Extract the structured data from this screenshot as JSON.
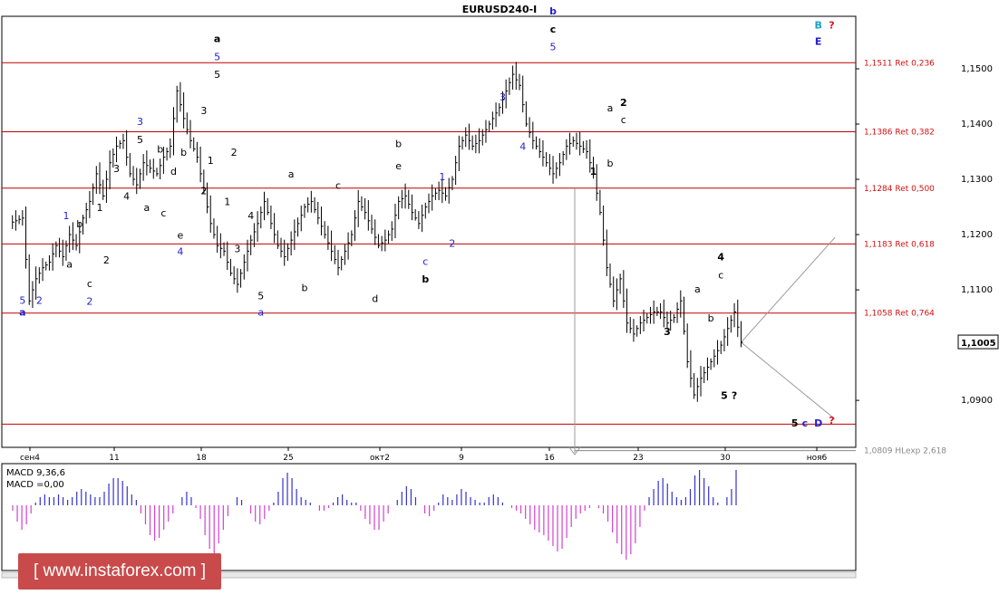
{
  "title": "EURUSD240-I",
  "chart_data": [
    {
      "type": "ohlc",
      "title": "EURUSD240-I",
      "ylim": [
        1.0815,
        1.1595
      ],
      "price_ticks": [
        "1,1500",
        "1,1400",
        "1,1300",
        "1,1200",
        "1,1100",
        "1,0900"
      ],
      "price_tick_values": [
        1.15,
        1.14,
        1.13,
        1.12,
        1.11,
        1.09
      ],
      "x_ticks": [
        "сен4",
        "11",
        "18",
        "25",
        "окт2",
        "9",
        "16",
        "23",
        "30",
        "ноя6"
      ],
      "current_price": "1,1005",
      "current_price_value": 1.1005,
      "fib_levels": [
        {
          "label": "1,1511 Ret 0,236",
          "value": 1.1511
        },
        {
          "label": "1,1386 Ret 0,382",
          "value": 1.1386
        },
        {
          "label": "1,1284 Ret 0,500",
          "value": 1.1284
        },
        {
          "label": "1,1183 Ret 0,618",
          "value": 1.1183
        },
        {
          "label": "1,1058 Ret 0,764",
          "value": 1.1058
        }
      ],
      "extra_level": {
        "value": 1.0857
      },
      "extension_level": {
        "label": "1,0809 HLexp 2,618",
        "value": 1.0809
      },
      "price_path": [
        [
          0,
          1.122
        ],
        [
          4,
          1.123
        ],
        [
          6,
          1.108
        ],
        [
          8,
          1.112
        ],
        [
          10,
          1.114
        ],
        [
          12,
          1.115
        ],
        [
          14,
          1.118
        ],
        [
          16,
          1.116
        ],
        [
          18,
          1.12
        ],
        [
          20,
          1.118
        ],
        [
          22,
          1.123
        ],
        [
          24,
          1.126
        ],
        [
          26,
          1.131
        ],
        [
          28,
          1.127
        ],
        [
          30,
          1.133
        ],
        [
          32,
          1.136
        ],
        [
          34,
          1.137
        ],
        [
          36,
          1.131
        ],
        [
          38,
          1.129
        ],
        [
          40,
          1.133
        ],
        [
          42,
          1.132
        ],
        [
          44,
          1.131
        ],
        [
          46,
          1.134
        ],
        [
          48,
          1.136
        ],
        [
          50,
          1.146
        ],
        [
          52,
          1.141
        ],
        [
          54,
          1.137
        ],
        [
          56,
          1.134
        ],
        [
          58,
          1.128
        ],
        [
          60,
          1.122
        ],
        [
          62,
          1.118
        ],
        [
          64,
          1.117
        ],
        [
          66,
          1.113
        ],
        [
          68,
          1.111
        ],
        [
          70,
          1.115
        ],
        [
          72,
          1.119
        ],
        [
          74,
          1.122
        ],
        [
          76,
          1.126
        ],
        [
          78,
          1.122
        ],
        [
          80,
          1.118
        ],
        [
          82,
          1.116
        ],
        [
          84,
          1.119
        ],
        [
          86,
          1.122
        ],
        [
          88,
          1.125
        ],
        [
          90,
          1.126
        ],
        [
          92,
          1.123
        ],
        [
          94,
          1.12
        ],
        [
          96,
          1.117
        ],
        [
          98,
          1.114
        ],
        [
          100,
          1.117
        ],
        [
          102,
          1.12
        ],
        [
          104,
          1.126
        ],
        [
          106,
          1.124
        ],
        [
          108,
          1.121
        ],
        [
          110,
          1.118
        ],
        [
          112,
          1.119
        ],
        [
          114,
          1.121
        ],
        [
          116,
          1.126
        ],
        [
          118,
          1.127
        ],
        [
          120,
          1.124
        ],
        [
          122,
          1.122
        ],
        [
          124,
          1.125
        ],
        [
          126,
          1.127
        ],
        [
          128,
          1.128
        ],
        [
          130,
          1.127
        ],
        [
          132,
          1.13
        ],
        [
          134,
          1.136
        ],
        [
          136,
          1.138
        ],
        [
          138,
          1.136
        ],
        [
          140,
          1.137
        ],
        [
          142,
          1.139
        ],
        [
          144,
          1.141
        ],
        [
          146,
          1.143
        ],
        [
          148,
          1.146
        ],
        [
          150,
          1.149
        ],
        [
          152,
          1.147
        ],
        [
          154,
          1.14
        ],
        [
          156,
          1.137
        ],
        [
          158,
          1.135
        ],
        [
          160,
          1.133
        ],
        [
          162,
          1.131
        ],
        [
          164,
          1.133
        ],
        [
          166,
          1.136
        ],
        [
          168,
          1.137
        ],
        [
          170,
          1.136
        ],
        [
          172,
          1.135
        ],
        [
          174,
          1.131
        ],
        [
          176,
          1.124
        ],
        [
          178,
          1.114
        ],
        [
          180,
          1.108
        ],
        [
          182,
          1.112
        ],
        [
          184,
          1.104
        ],
        [
          186,
          1.102
        ],
        [
          188,
          1.104
        ],
        [
          190,
          1.105
        ],
        [
          192,
          1.106
        ],
        [
          194,
          1.106
        ],
        [
          196,
          1.104
        ],
        [
          198,
          1.105
        ],
        [
          200,
          1.108
        ],
        [
          202,
          1.097
        ],
        [
          204,
          1.091
        ],
        [
          206,
          1.094
        ],
        [
          208,
          1.096
        ],
        [
          210,
          1.098
        ],
        [
          212,
          1.1
        ],
        [
          214,
          1.103
        ],
        [
          216,
          1.106
        ],
        [
          218,
          1.1005
        ]
      ],
      "indicator": {
        "name": "MACD",
        "label_line1": "MACD 9,36,6",
        "label_line2": "MACD =0,00",
        "histogram": [
          -0.2,
          -0.6,
          -0.9,
          -0.7,
          -0.3,
          0.1,
          0.3,
          0.4,
          0.3,
          0.3,
          0.4,
          0.3,
          0.2,
          0.3,
          0.5,
          0.6,
          0.5,
          0.4,
          0.3,
          0.3,
          0.5,
          0.8,
          1.0,
          1.0,
          0.9,
          0.7,
          0.4,
          0.2,
          -0.3,
          -0.7,
          -1.1,
          -1.3,
          -1.2,
          -0.9,
          -0.6,
          -0.3,
          0.0,
          0.3,
          0.5,
          0.3,
          -0.1,
          -0.5,
          -1.1,
          -1.6,
          -1.8,
          -1.4,
          -0.9,
          -0.4,
          0.0,
          0.3,
          0.2,
          0.0,
          -0.3,
          -0.6,
          -0.7,
          -0.5,
          -0.2,
          0.1,
          0.5,
          1.0,
          1.2,
          1.0,
          0.6,
          0.3,
          0.2,
          0.1,
          0.0,
          -0.2,
          -0.2,
          -0.1,
          0.1,
          0.3,
          0.4,
          0.2,
          0.1,
          0.1,
          -0.2,
          -0.5,
          -0.7,
          -0.9,
          -0.9,
          -0.6,
          -0.3,
          0.0,
          0.2,
          0.5,
          0.7,
          0.6,
          0.3,
          0.0,
          -0.3,
          -0.4,
          -0.2,
          0.1,
          0.4,
          0.3,
          0.2,
          0.4,
          0.6,
          0.5,
          0.3,
          0.2,
          0.1,
          0.1,
          0.3,
          0.4,
          0.3,
          0.1,
          0.0,
          -0.1,
          -0.2,
          -0.3,
          -0.5,
          -0.7,
          -0.9,
          -1.0,
          -1.1,
          -1.3,
          -1.5,
          -1.7,
          -1.6,
          -1.2,
          -0.8,
          -0.5,
          -0.3,
          -0.2,
          -0.1,
          0.0,
          -0.1,
          -0.3,
          -0.6,
          -1.0,
          -1.4,
          -1.8,
          -2.0,
          -1.8,
          -1.4,
          -0.8,
          -0.2,
          0.3,
          0.6,
          0.9,
          1.0,
          0.8,
          0.5,
          0.3,
          0.2,
          0.3,
          0.6,
          1.1,
          1.3,
          1.0,
          0.7,
          0.3,
          0.1,
          0.0,
          0.3,
          0.6,
          1.3
        ]
      }
    }
  ],
  "wave_labels": [
    {
      "text": "5",
      "x": 4,
      "y": 1.1075,
      "color": "#1f1fd1"
    },
    {
      "text": "a",
      "x": 4,
      "y": 1.1073,
      "color": "#1f1fd1",
      "bold": true,
      "dy": 12
    },
    {
      "text": "2",
      "x": 9,
      "y": 1.1075,
      "color": "#1f1fd1"
    },
    {
      "text": "1",
      "x": 17,
      "y": 1.1228,
      "color": "#1f1fd1"
    },
    {
      "text": "a",
      "x": 18,
      "y": 1.114,
      "color": "#000000"
    },
    {
      "text": "b",
      "x": 21,
      "y": 1.1213,
      "color": "#000000"
    },
    {
      "text": "c",
      "x": 24,
      "y": 1.1105,
      "color": "#000000"
    },
    {
      "text": "2",
      "x": 24,
      "y": 1.1093,
      "color": "#1f1fd1",
      "dy": 12
    },
    {
      "text": "1",
      "x": 27,
      "y": 1.1243,
      "color": "#000000"
    },
    {
      "text": "2",
      "x": 29,
      "y": 1.1148,
      "color": "#000000"
    },
    {
      "text": "3",
      "x": 32,
      "y": 1.1313,
      "color": "#000000"
    },
    {
      "text": "4",
      "x": 35,
      "y": 1.1263,
      "color": "#000000"
    },
    {
      "text": "3",
      "x": 39,
      "y": 1.1398,
      "color": "#1f1fd1"
    },
    {
      "text": "5",
      "x": 39,
      "y": 1.1385,
      "color": "#000000",
      "dy": 12
    },
    {
      "text": "a",
      "x": 41,
      "y": 1.1243,
      "color": "#000000"
    },
    {
      "text": "b",
      "x": 45,
      "y": 1.1348,
      "color": "#000000"
    },
    {
      "text": "c",
      "x": 46,
      "y": 1.1233,
      "color": "#000000"
    },
    {
      "text": "d",
      "x": 49,
      "y": 1.1308,
      "color": "#000000"
    },
    {
      "text": "b",
      "x": 52,
      "y": 1.1343,
      "color": "#000000"
    },
    {
      "text": "e",
      "x": 51,
      "y": 1.1193,
      "color": "#000000"
    },
    {
      "text": "4",
      "x": 51,
      "y": 1.1183,
      "color": "#1f1fd1",
      "dy": 12
    },
    {
      "text": "3",
      "x": 58,
      "y": 1.1418,
      "color": "#000000"
    },
    {
      "text": "2",
      "x": 58,
      "y": 1.1273,
      "color": "#000000"
    },
    {
      "text": "1",
      "x": 60,
      "y": 1.1328,
      "color": "#000000"
    },
    {
      "text": "2",
      "x": 67,
      "y": 1.1343,
      "color": "#000000"
    },
    {
      "text": "1",
      "x": 65,
      "y": 1.1253,
      "color": "#000000"
    },
    {
      "text": "a",
      "x": 62,
      "y": 1.1548,
      "color": "#000000",
      "bold": true
    },
    {
      "text": "5",
      "x": 62,
      "y": 1.1535,
      "color": "#1f1fd1",
      "dy": 12
    },
    {
      "text": "5",
      "x": 62,
      "y": 1.1523,
      "color": "#000000",
      "dy": 24
    },
    {
      "text": "4",
      "x": 72,
      "y": 1.1228,
      "color": "#000000"
    },
    {
      "text": "3",
      "x": 68,
      "y": 1.1168,
      "color": "#000000"
    },
    {
      "text": "5",
      "x": 75,
      "y": 1.1083,
      "color": "#000000"
    },
    {
      "text": "a",
      "x": 75,
      "y": 1.1073,
      "color": "#1f1fd1",
      "dy": 12
    },
    {
      "text": "b",
      "x": 88,
      "y": 1.1098,
      "color": "#000000"
    },
    {
      "text": "a",
      "x": 84,
      "y": 1.1303,
      "color": "#000000"
    },
    {
      "text": "c",
      "x": 98,
      "y": 1.1283,
      "color": "#000000"
    },
    {
      "text": "d",
      "x": 109,
      "y": 1.1078,
      "color": "#000000"
    },
    {
      "text": "b",
      "x": 116,
      "y": 1.1358,
      "color": "#000000"
    },
    {
      "text": "e",
      "x": 116,
      "y": 1.1338,
      "color": "#000000",
      "dy": 12
    },
    {
      "text": "c",
      "x": 124,
      "y": 1.1145,
      "color": "#1f1fd1"
    },
    {
      "text": "b",
      "x": 124,
      "y": 1.1133,
      "color": "#000000",
      "bold": true,
      "dy": 12
    },
    {
      "text": "1",
      "x": 129,
      "y": 1.1298,
      "color": "#1f1fd1"
    },
    {
      "text": "2",
      "x": 132,
      "y": 1.1178,
      "color": "#1f1fd1"
    },
    {
      "text": "3",
      "x": 147,
      "y": 1.1443,
      "color": "#1f1fd1"
    },
    {
      "text": "4",
      "x": 153,
      "y": 1.1353,
      "color": "#1f1fd1"
    },
    {
      "text": "b",
      "x": 162,
      "y": 1.1598,
      "color": "#1f1fd1",
      "bold": true
    },
    {
      "text": "c",
      "x": 162,
      "y": 1.1585,
      "color": "#000000",
      "bold": true,
      "dy": 12
    },
    {
      "text": "5",
      "x": 162,
      "y": 1.1573,
      "color": "#1f1fd1",
      "dy": 24
    },
    {
      "text": "a",
      "x": 179,
      "y": 1.1423,
      "color": "#000000"
    },
    {
      "text": "2",
      "x": 183,
      "y": 1.1433,
      "color": "#000000",
      "bold": true
    },
    {
      "text": "c",
      "x": 183,
      "y": 1.1421,
      "color": "#000000",
      "dy": 12
    },
    {
      "text": "b",
      "x": 179,
      "y": 1.1323,
      "color": "#000000"
    },
    {
      "text": "1",
      "x": 174,
      "y": 1.1308,
      "color": "#000000",
      "bold": true
    },
    {
      "text": "3",
      "x": 196,
      "y": 1.1018,
      "color": "#000000",
      "bold": true
    },
    {
      "text": "4",
      "x": 212,
      "y": 1.1153,
      "color": "#000000",
      "bold": true
    },
    {
      "text": "c",
      "x": 212,
      "y": 1.114,
      "color": "#000000",
      "dy": 12
    },
    {
      "text": "a",
      "x": 205,
      "y": 1.1095,
      "color": "#000000"
    },
    {
      "text": "b",
      "x": 209,
      "y": 1.1043,
      "color": "#000000"
    },
    {
      "text": "5",
      "x": 213,
      "y": 1.0903,
      "color": "#000000",
      "bold": true
    },
    {
      "text": "?",
      "x": 216,
      "y": 1.0903,
      "color": "#000000",
      "bold": true
    },
    {
      "text": "B",
      "x": 241,
      "y": 1.1573,
      "color": "#1aa0c8",
      "bold": true
    },
    {
      "text": "?",
      "x": 245,
      "y": 1.1573,
      "color": "#e01020",
      "bold": true
    },
    {
      "text": "E",
      "x": 241,
      "y": 1.1543,
      "color": "#1f1fd1",
      "bold": true
    },
    {
      "text": "5",
      "x": 234,
      "y": 1.0853,
      "color": "#000000",
      "bold": true
    },
    {
      "text": "c",
      "x": 237,
      "y": 1.0853,
      "color": "#1f1fd1",
      "bold": true
    },
    {
      "text": "D",
      "x": 241,
      "y": 1.0853,
      "color": "#1f1fd1",
      "bold": true
    },
    {
      "text": "?",
      "x": 245,
      "y": 1.0858,
      "color": "#e01020",
      "bold": true
    }
  ],
  "watermark": "[ www.instaforex.com ]",
  "colors": {
    "fib_line": "#c00000",
    "fib_text": "#d01010",
    "hist_positive": "#3333cc",
    "hist_negative": "#d042d0",
    "price_bar": "#000000",
    "projection": "#9a9a9a",
    "watermark_bg": "#c94a4a"
  }
}
